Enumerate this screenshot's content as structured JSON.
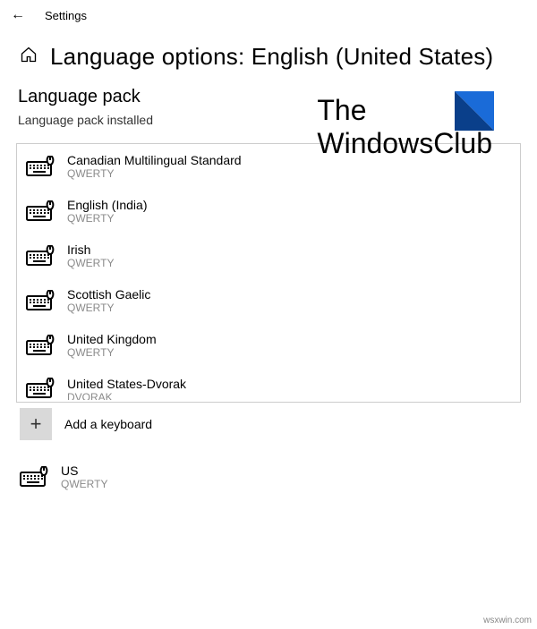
{
  "topbar": {
    "app_name": "Settings"
  },
  "header": {
    "title": "Language options: English (United States)"
  },
  "language_pack": {
    "heading": "Language pack",
    "status": "Language pack installed"
  },
  "watermark": {
    "line1": "The",
    "line2": "WindowsClub"
  },
  "keyboards_box": [
    {
      "name": "Canadian Multilingual Standard",
      "layout": "QWERTY"
    },
    {
      "name": "English (India)",
      "layout": "QWERTY"
    },
    {
      "name": "Irish",
      "layout": "QWERTY"
    },
    {
      "name": "Scottish Gaelic",
      "layout": "QWERTY"
    },
    {
      "name": "United Kingdom",
      "layout": "QWERTY"
    },
    {
      "name": "United States-Dvorak",
      "layout": "DVORAK"
    }
  ],
  "add_keyboard": {
    "label": "Add a keyboard"
  },
  "keyboards_below": [
    {
      "name": "US",
      "layout": "QWERTY"
    }
  ],
  "attribution": "wsxwin.com"
}
